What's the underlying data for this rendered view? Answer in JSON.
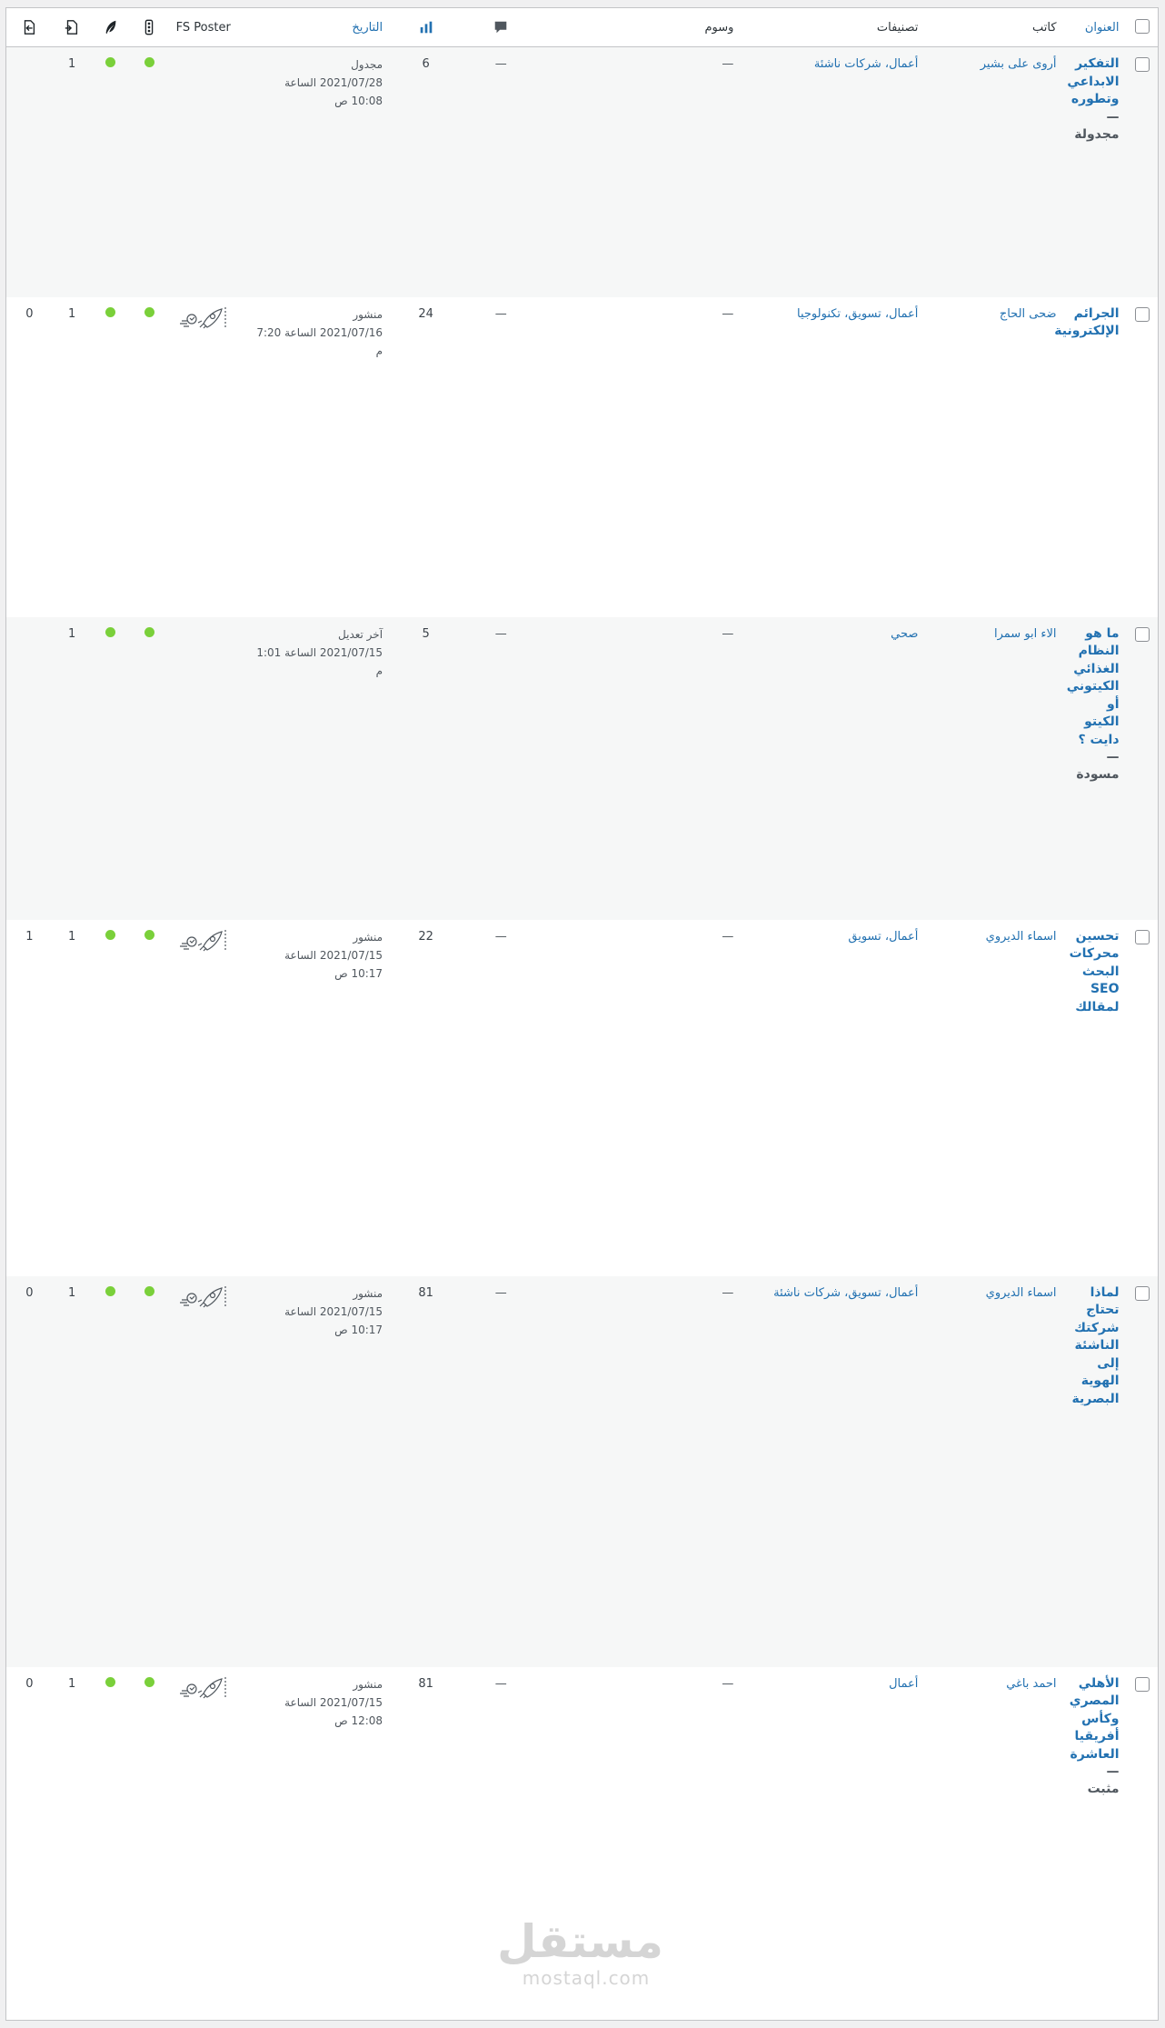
{
  "columns": {
    "title": "العنوان",
    "author": "كاتب",
    "categories": "تصنيفات",
    "tags": "وسوم",
    "date": "التاريخ",
    "fs_poster": "FS Poster",
    "comments_icon": "comment-bubble-icon",
    "views_icon": "bar-chart-icon"
  },
  "rows": [
    {
      "title": "التفكير الابداعي وتطوره",
      "state": " — مجدولة",
      "author": "أروى على بشير",
      "categories": "أعمال، شركات ناشئة",
      "tags": "—",
      "comments": "—",
      "views": "6",
      "status": "مجدول",
      "date": "2021/07/28 الساعة 10:08 ص",
      "fs": "",
      "c1": "1",
      "c2": ""
    },
    {
      "title": "الجرائم الإلكترونية",
      "state": "",
      "author": "ضحى الحاج",
      "categories": "أعمال، تسويق، تكنولوجيا",
      "tags": "—",
      "comments": "—",
      "views": "24",
      "status": "منشور",
      "date": "2021/07/16 الساعة 7:20 م",
      "fs": "rocket",
      "c1": "1",
      "c2": "0"
    },
    {
      "title": "ما هو النظام الغذائي الكيتوني أو الكيتو دايت ؟",
      "state": " — مسودة",
      "author": "الاء ابو سمرا",
      "categories": "صحي",
      "tags": "—",
      "comments": "—",
      "views": "5",
      "status": "آخر تعديل",
      "date": "2021/07/15 الساعة 1:01 م",
      "fs": "",
      "c1": "1",
      "c2": ""
    },
    {
      "title": "تحسين محركات البحث SEO لمقالك",
      "state": "",
      "author": "اسماء الديروي",
      "categories": "أعمال، تسويق",
      "tags": "—",
      "comments": "—",
      "views": "22",
      "status": "منشور",
      "date": "2021/07/15 الساعة 10:17 ص",
      "fs": "rocket",
      "c1": "1",
      "c2": "1"
    },
    {
      "title": "لماذا تحتاج شركتك الناشئة إلى الهوية البصرية",
      "state": "",
      "author": "اسماء الديروي",
      "categories": "أعمال، تسويق، شركات ناشئة",
      "tags": "—",
      "comments": "—",
      "views": "81",
      "status": "منشور",
      "date": "2021/07/15 الساعة 10:17 ص",
      "fs": "rocket",
      "c1": "1",
      "c2": "0"
    },
    {
      "title": "الأهلي المصري وكأس أفريقيا العاشرة",
      "state": " — مثبت",
      "author": "احمد باغي",
      "categories": "أعمال",
      "tags": "—",
      "comments": "—",
      "views": "81",
      "status": "منشور",
      "date": "2021/07/15 الساعة 12:08 ص",
      "fs": "rocket",
      "c1": "1",
      "c2": "0"
    }
  ],
  "watermark": {
    "arabic": "مستقل",
    "latin": "mostaql.com"
  },
  "colors": {
    "link": "#2271b1",
    "status_dot": "#7ad03a",
    "alt_row": "#f6f7f7"
  }
}
